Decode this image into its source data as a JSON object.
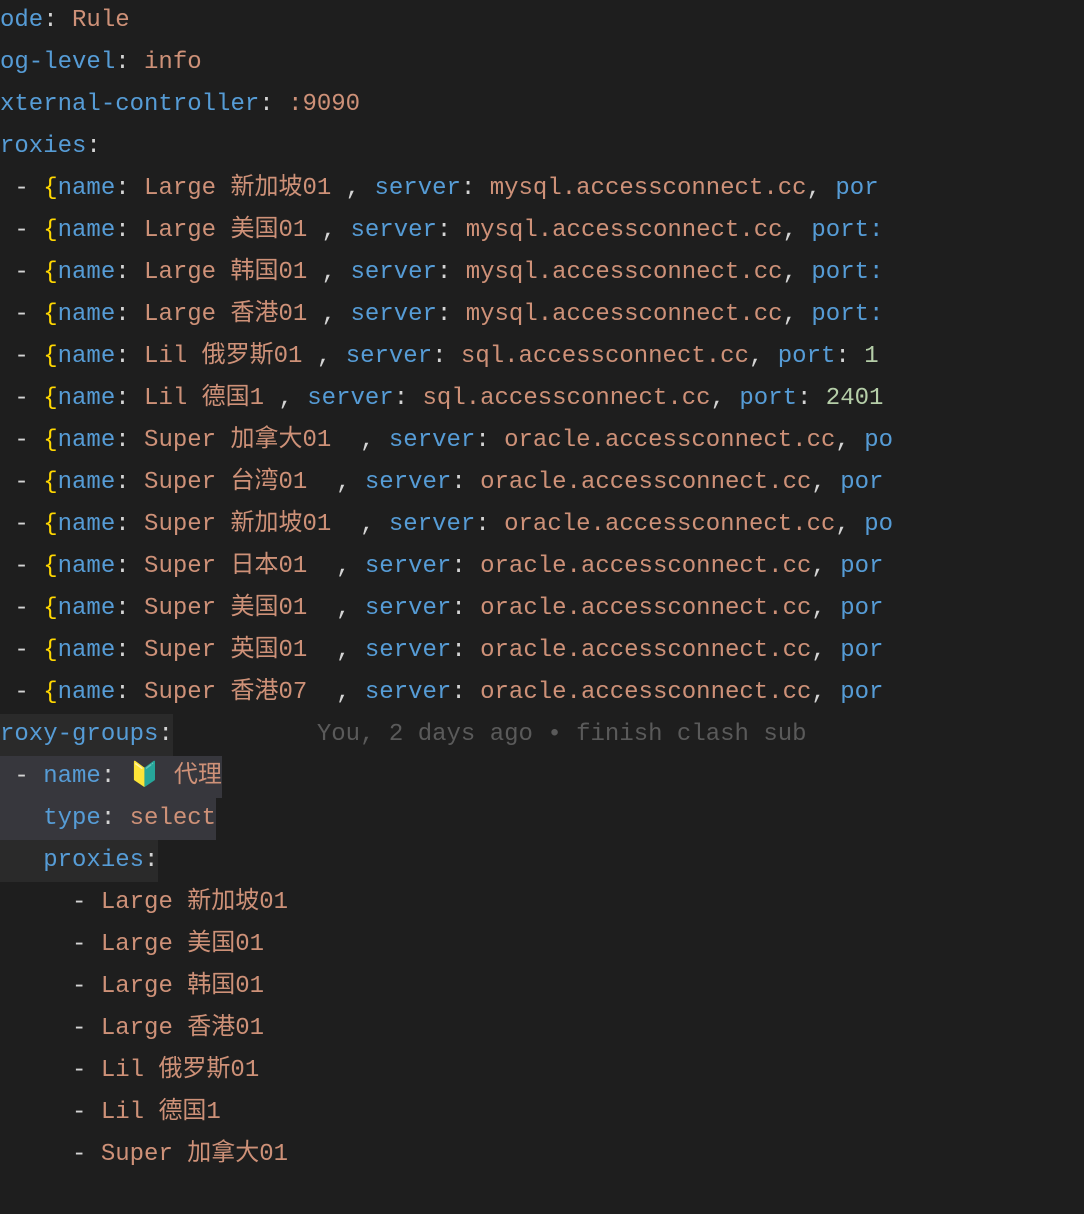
{
  "config": {
    "mode_key": "ode",
    "mode_value": "Rule",
    "loglevel_key": "og-level",
    "loglevel_value": "info",
    "extcontroller_key": "xternal-controller",
    "extcontroller_value": ":9090",
    "proxies_key": "roxies",
    "proxygroups_key": "roxy-groups"
  },
  "proxies": [
    {
      "name": "Large 新加坡01 ",
      "server": "mysql.accessconnect.cc",
      "tail": "por"
    },
    {
      "name": "Large 美国01 ",
      "server": "mysql.accessconnect.cc",
      "tail": "port:"
    },
    {
      "name": "Large 韩国01 ",
      "server": "mysql.accessconnect.cc",
      "tail": "port:"
    },
    {
      "name": "Large 香港01 ",
      "server": "mysql.accessconnect.cc",
      "tail": "port:"
    },
    {
      "name": "Lil 俄罗斯01 ",
      "server": "sql.accessconnect.cc",
      "tail_key": "port",
      "tail_num": "1"
    },
    {
      "name": "Lil 德国1 ",
      "server": "sql.accessconnect.cc",
      "tail_key": "port",
      "tail_num": "2401"
    },
    {
      "name": "Super 加拿大01  ",
      "server": "oracle.accessconnect.cc",
      "tail": "po"
    },
    {
      "name": "Super 台湾01  ",
      "server": "oracle.accessconnect.cc",
      "tail": "por"
    },
    {
      "name": "Super 新加坡01  ",
      "server": "oracle.accessconnect.cc",
      "tail": "po"
    },
    {
      "name": "Super 日本01  ",
      "server": "oracle.accessconnect.cc",
      "tail": "por"
    },
    {
      "name": "Super 美国01  ",
      "server": "oracle.accessconnect.cc",
      "tail": "por"
    },
    {
      "name": "Super 英国01  ",
      "server": "oracle.accessconnect.cc",
      "tail": "por"
    },
    {
      "name": "Super 香港07  ",
      "server": "oracle.accessconnect.cc",
      "tail": "por"
    }
  ],
  "gitlens": "You, 2 days ago • finish clash sub",
  "group": {
    "name_key": "name",
    "name_value": "🔰 代理",
    "type_key": "type",
    "type_value": "select",
    "proxies_key": "proxies",
    "items": [
      "Large 新加坡01",
      "Large 美国01",
      "Large 韩国01",
      "Large 香港01",
      "Lil 俄罗斯01",
      "Lil 德国1",
      "Super 加拿大01"
    ]
  }
}
